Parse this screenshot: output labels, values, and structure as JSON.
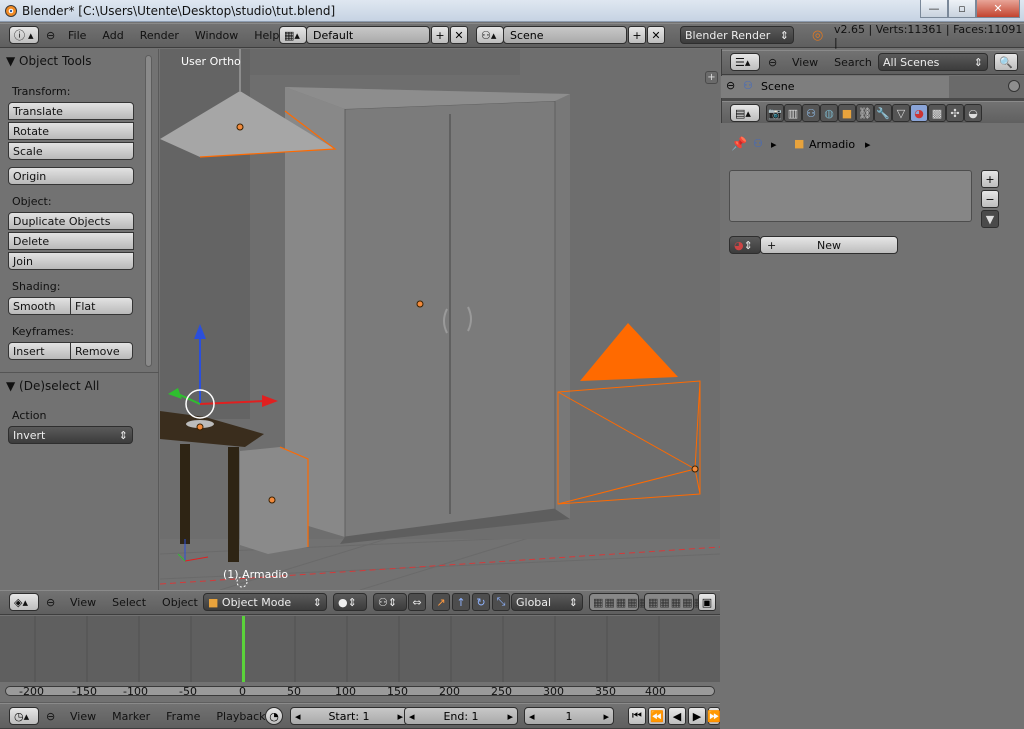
{
  "window": {
    "title": "Blender* [C:\\Users\\Utente\\Desktop\\studio\\tut.blend]",
    "min_label": "—",
    "max_label": "▫",
    "close_label": "✕"
  },
  "info_header": {
    "menus": [
      "File",
      "Add",
      "Render",
      "Window",
      "Help"
    ],
    "screen_layout": "Default",
    "scene": "Scene",
    "render_engine": "Blender Render",
    "stats": "v2.65 | Verts:11361 | Faces:11091 |"
  },
  "toolshelf": {
    "panel_title": "Object Tools",
    "transform_label": "Transform:",
    "translate": "Translate",
    "rotate": "Rotate",
    "scale": "Scale",
    "origin": "Origin",
    "object_label": "Object:",
    "duplicate": "Duplicate Objects",
    "delete": "Delete",
    "join": "Join",
    "shading_label": "Shading:",
    "smooth": "Smooth",
    "flat": "Flat",
    "keyframes_label": "Keyframes:",
    "insert": "Insert",
    "remove": "Remove",
    "operator_title": "(De)select All",
    "action_label": "Action",
    "action_value": "Invert"
  },
  "viewport": {
    "view_name": "User Ortho",
    "object_label": "(1) Armadio",
    "accent_color": "#ff6a00"
  },
  "viewport_header": {
    "menus": [
      "View",
      "Select",
      "Object"
    ],
    "mode": "Object Mode",
    "orientation": "Global"
  },
  "timeline": {
    "ticks": [
      "-200",
      "-150",
      "-100",
      "-50",
      "0",
      "50",
      "100",
      "150",
      "200",
      "250",
      "300",
      "350",
      "400"
    ],
    "playhead_color": "#5ad33a"
  },
  "timeline_header": {
    "menus": [
      "View",
      "Marker",
      "Frame",
      "Playback"
    ],
    "start": "Start: 1",
    "end": "End: 1",
    "current": "1"
  },
  "outliner_header": {
    "menus": [
      "View",
      "Search"
    ],
    "filter": "All Scenes",
    "scene_item": "Scene"
  },
  "properties": {
    "object_name": "Armadio",
    "new_label": "New"
  }
}
